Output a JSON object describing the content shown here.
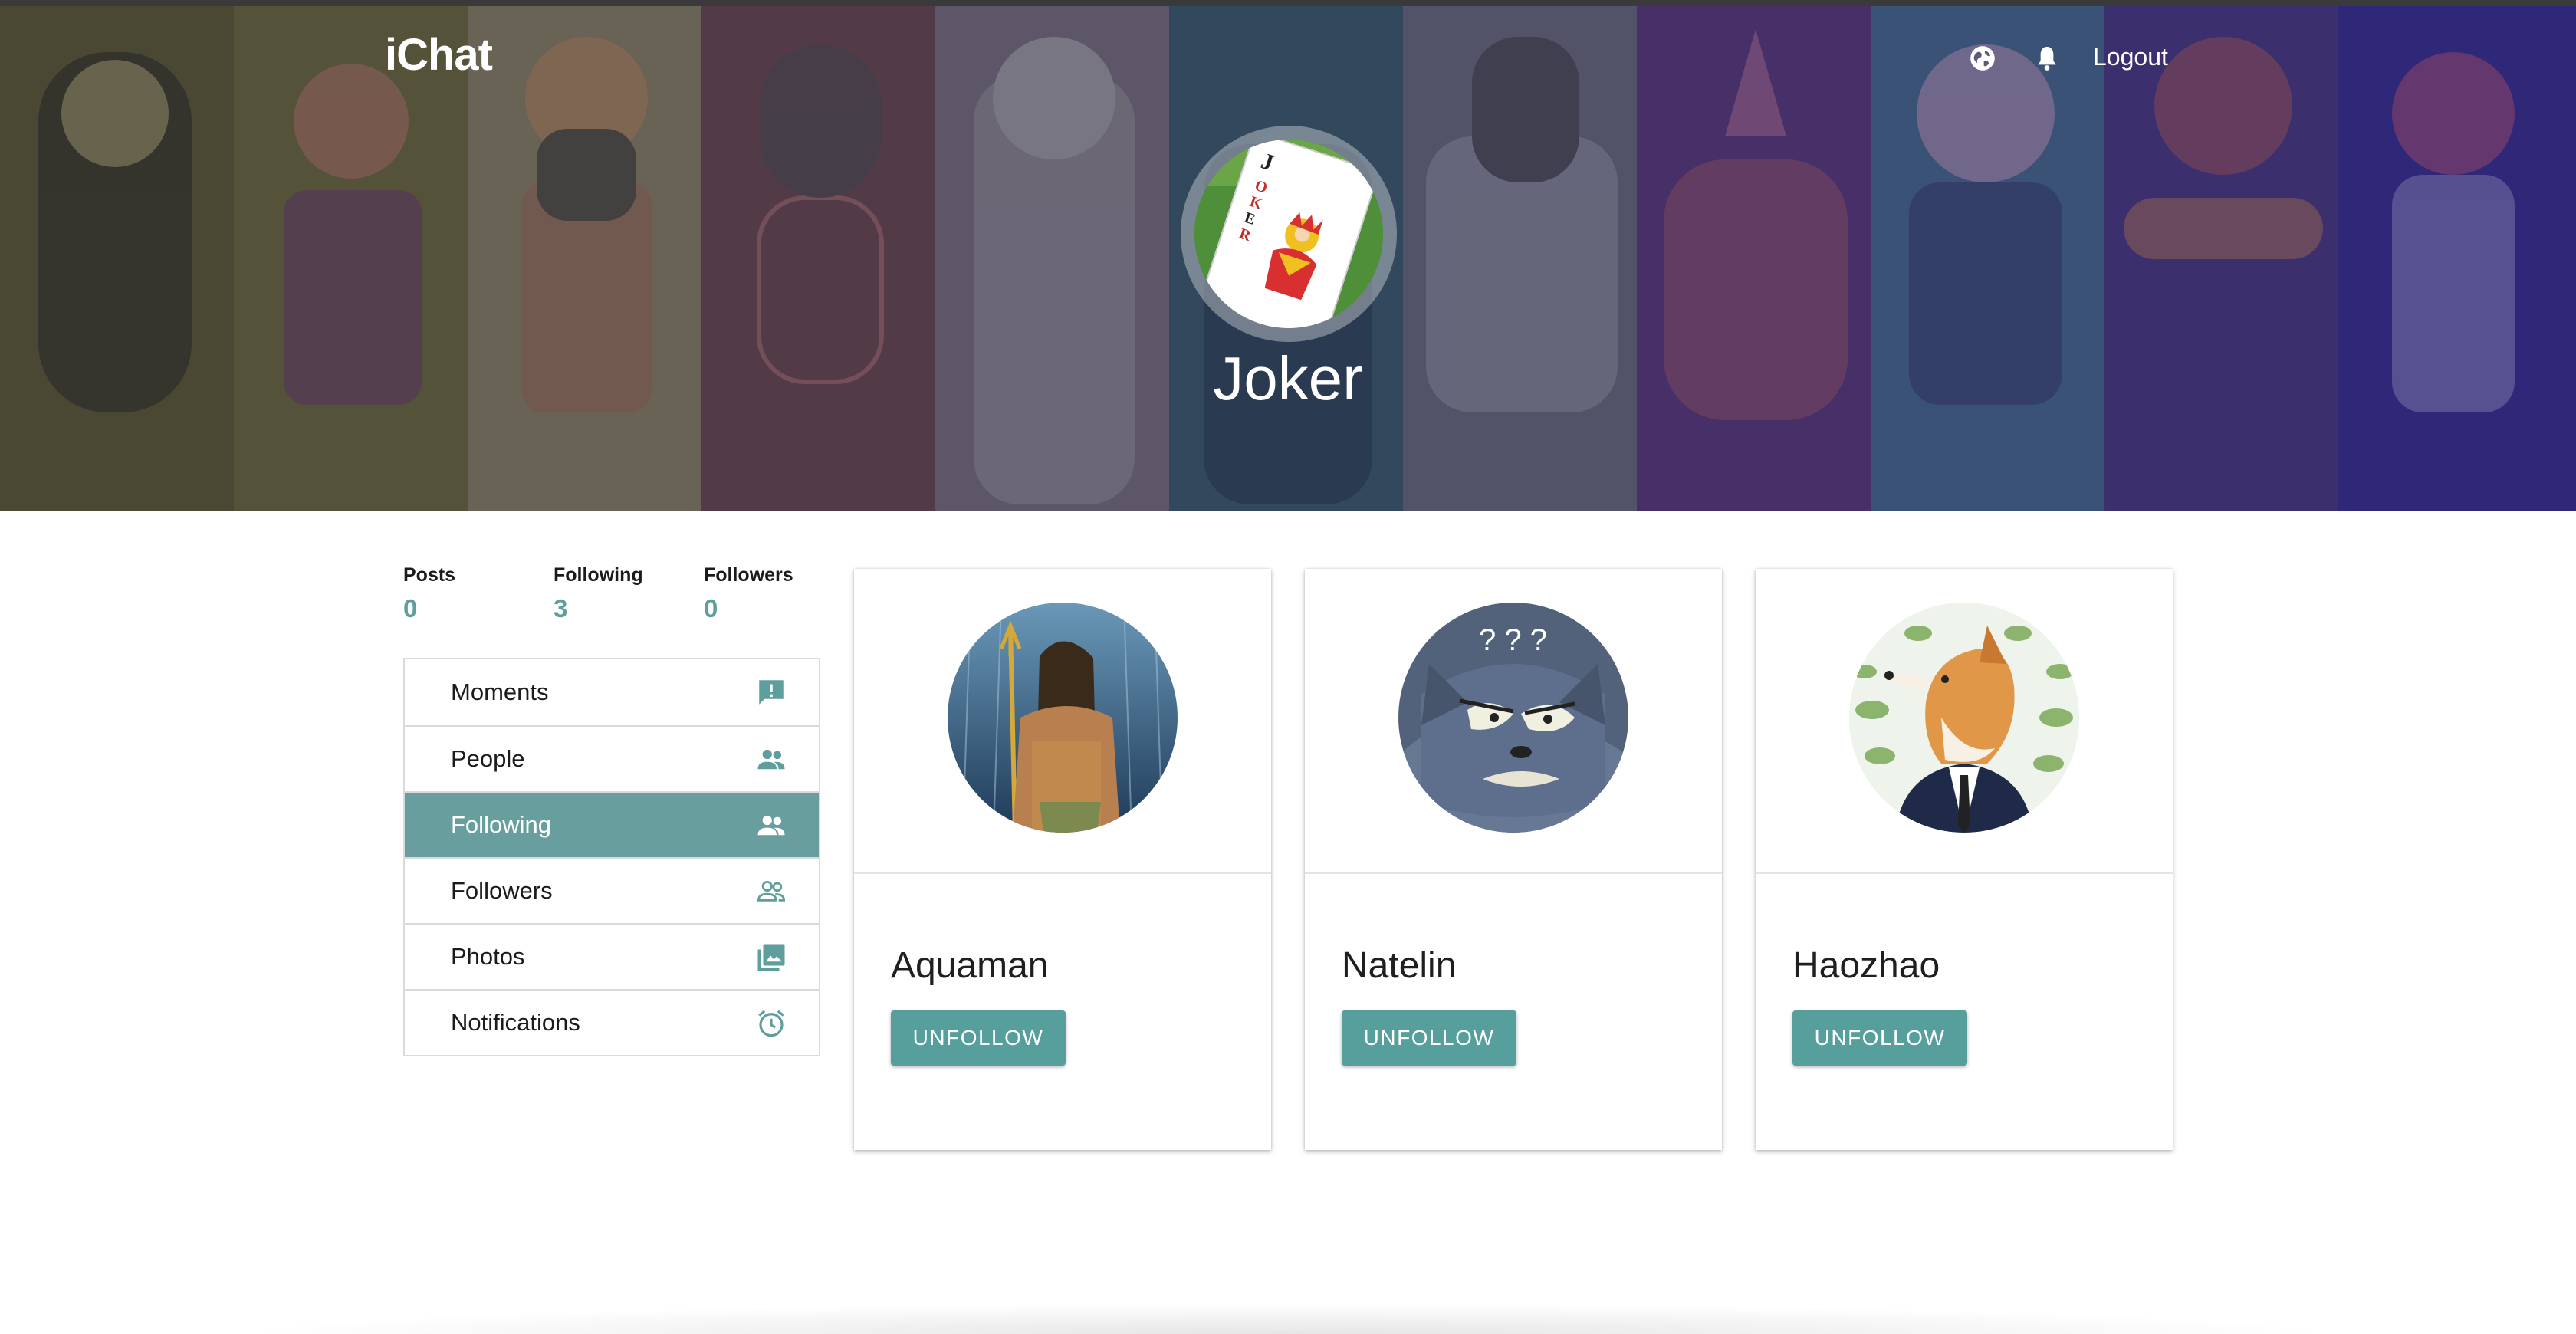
{
  "app": {
    "brand": "iChat"
  },
  "header": {
    "logout_label": "Logout",
    "icons": [
      "globe-icon",
      "bell-icon"
    ]
  },
  "profile": {
    "name": "Joker"
  },
  "stats": [
    {
      "label": "Posts",
      "value": "0"
    },
    {
      "label": "Following",
      "value": "3"
    },
    {
      "label": "Followers",
      "value": "0"
    }
  ],
  "sidebar": {
    "items": [
      {
        "label": "Moments",
        "icon": "feedback-icon",
        "active": false
      },
      {
        "label": "People",
        "icon": "people-icon",
        "active": false
      },
      {
        "label": "Following",
        "icon": "people-icon",
        "active": true
      },
      {
        "label": "Followers",
        "icon": "people-outline-icon",
        "active": false
      },
      {
        "label": "Photos",
        "icon": "photo-library-icon",
        "active": false
      },
      {
        "label": "Notifications",
        "icon": "alarm-icon",
        "active": false
      }
    ]
  },
  "following": [
    {
      "name": "Aquaman",
      "action": "UNFOLLOW"
    },
    {
      "name": "Natelin",
      "action": "UNFOLLOW"
    },
    {
      "name": "Haozhao",
      "action": "UNFOLLOW"
    }
  ],
  "colors": {
    "accent": "#579f9c",
    "active_menu": "#689f9e",
    "stat_value": "#5e9e9d"
  }
}
